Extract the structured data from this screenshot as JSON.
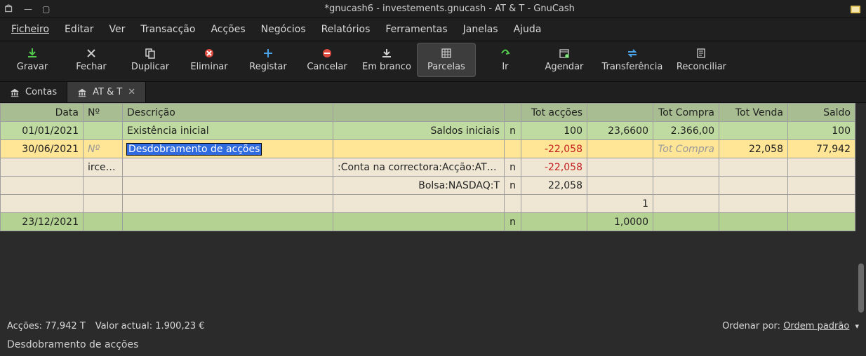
{
  "titlebar": {
    "title": "*gnucash6 - investements.gnucash - AT & T - GnuCash"
  },
  "menubar": [
    "Ficheiro",
    "Editar",
    "Ver",
    "Transacção",
    "Acções",
    "Negócios",
    "Relatórios",
    "Ferramentas",
    "Janelas",
    "Ajuda"
  ],
  "toolbar": {
    "gravar": "Gravar",
    "fechar": "Fechar",
    "duplicar": "Duplicar",
    "eliminar": "Eliminar",
    "registar": "Registar",
    "cancelar": "Cancelar",
    "embranco": "Em branco",
    "parcelas": "Parcelas",
    "ir": "Ir",
    "agendar": "Agendar",
    "transferencia": "Transferência",
    "reconciliar": "Reconciliar"
  },
  "tabs": {
    "contas": "Contas",
    "att": "AT & T"
  },
  "columns": {
    "data": "Data",
    "no": "Nº",
    "descricao": "Descrição",
    "blank1": "",
    "blank2": "",
    "totaccoes": "Tot acções",
    "blank3": "",
    "totcompra": "Tot Compra",
    "totvenda": "Tot Venda",
    "saldo": "Saldo"
  },
  "rows": {
    "r1": {
      "date": "01/01/2021",
      "no": "",
      "desc": "Existência inicial",
      "acct": "Saldos iniciais",
      "flag": "n",
      "shares": "100",
      "price": "23,6600",
      "buy": "2.366,00",
      "sell": "",
      "balance": "100"
    },
    "r2": {
      "date": "30/06/2021",
      "no_ph": "Nº",
      "desc": "Desdobramento de acções",
      "shares": "-22,058",
      "buy_ph": "Tot Compra",
      "sell": "22,058",
      "balance": "77,942"
    },
    "r3": {
      "label": "ircelas",
      "acct": ":Conta na correctora:Acção:AT & T",
      "flag": "n",
      "shares": "-22,058"
    },
    "r4": {
      "acct": "Bolsa:NASDAQ:T",
      "flag": "n",
      "shares": "22,058"
    },
    "r5": {
      "price": "1"
    },
    "r6": {
      "date": "23/12/2021",
      "flag": "n",
      "price": "1,0000"
    }
  },
  "status": {
    "shares_label": "Acções:",
    "shares_value": "77,942 T",
    "value_label": "Valor actual:",
    "value_value": "1.900,23 €",
    "sort_label": "Ordenar por:",
    "sort_value": "Ordem padrão",
    "bottom_msg": "Desdobramento de acções"
  }
}
